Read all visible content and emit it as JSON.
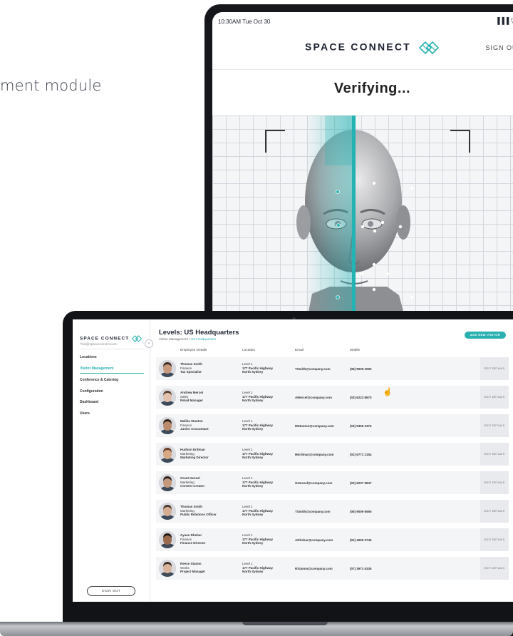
{
  "caption": "ment module",
  "tablet": {
    "time": "10:30AM Tue Oct 30",
    "status_icons": "▐▐▐ ▽ ▬",
    "brand": "SPACE CONNECT",
    "sign_out": "SIGN OUT",
    "verifying": "Verifying..."
  },
  "laptop": {
    "sidebar": {
      "brand": "SPACE CONNECT",
      "email": "Trial@spaceconnect.com",
      "collapse_icon": "‹",
      "nav": [
        "Locations",
        "Visitor Management",
        "Conference & Catering",
        "Configuration",
        "Dashboard",
        "Users"
      ],
      "active_index": 1,
      "sign_out": "SIGN OUT"
    },
    "main": {
      "title": "Levels: US Headquarters",
      "breadcrumb": {
        "root": "Visitor Management",
        "sep": " / ",
        "current": "US Headquarters"
      },
      "add_button": "ADD NEW VISITOR",
      "columns": {
        "employee": "Employee Details",
        "location": "Location",
        "email": "Email",
        "mobile": "Mobile"
      },
      "edit_label": "EDIT DETAILS",
      "rows": [
        {
          "name": "Thomas Smith",
          "dept": "Finance",
          "role": "Tax Specialist",
          "level": "Level 1",
          "street": "177 Pacific Highway",
          "city": "North Sydney",
          "email": "TSmith@company.com",
          "mobile": "(08) 9009 2093",
          "skin": "#c89a7d",
          "hair": "#3a2a22"
        },
        {
          "name": "Andrew Mercel",
          "dept": "Sales",
          "role": "Retail Manager",
          "level": "Level 1",
          "street": "177 Pacific Highway",
          "city": "North Sydney",
          "email": "AMercel@company.com",
          "mobile": "(03) 6223 8670",
          "skin": "#e2c2ae",
          "hair": "#5a4535"
        },
        {
          "name": "Malika Stanton",
          "dept": "Finance",
          "role": "Junior Accountant",
          "level": "Level 1",
          "street": "177 Pacific Highway",
          "city": "North Sydney",
          "email": "MStanton@company.com",
          "mobile": "(03) 5356 2376",
          "skin": "#b98a6b",
          "hair": "#2b1d16"
        },
        {
          "name": "Hudson Erdman",
          "dept": "Marketing",
          "role": "Marketing Director",
          "level": "Level 1",
          "street": "177 Pacific Highway",
          "city": "North Sydney",
          "email": "HErdman@company.com",
          "mobile": "(02) 6771 2154",
          "skin": "#d8a886",
          "hair": "#6a3f2a"
        },
        {
          "name": "Grant Hessel",
          "dept": "Marketing",
          "role": "Content Creator",
          "level": "Level 1",
          "street": "177 Pacific Highway",
          "city": "North Sydney",
          "email": "GHessel@company.com",
          "mobile": "(03) 6237 9847",
          "skin": "#c59a7c",
          "hair": "#2a2220"
        },
        {
          "name": "Thomas Smith",
          "dept": "Marketing",
          "role": "Public Relations Officer",
          "level": "Level 1",
          "street": "177 Pacific Highway",
          "city": "North Sydney",
          "email": "TSmith@company.com",
          "mobile": "(08) 9009 6565",
          "skin": "#d5ad92",
          "hair": "#4a3a30"
        },
        {
          "name": "Ayaan Dhebar",
          "dept": "Finance",
          "role": "Finance Director",
          "level": "Level 1",
          "street": "177 Pacific Highway",
          "city": "North Sydney",
          "email": "ADhebar@company.com",
          "mobile": "(02) 4055 0746",
          "skin": "#9a6a4e",
          "hair": "#1e1612"
        },
        {
          "name": "Reece Stamm",
          "dept": "Works",
          "role": "Project Manager",
          "level": "Level 1",
          "street": "177 Pacific Highway",
          "city": "North Sydney",
          "email": "RStamm@company.com",
          "mobile": "(07) 3971 6335",
          "skin": "#d9b49a",
          "hair": "#3d2f26"
        }
      ]
    }
  },
  "colors": {
    "accent": "#2ab0b0",
    "scan_line": "#23b3b3",
    "device": "#15171c"
  }
}
